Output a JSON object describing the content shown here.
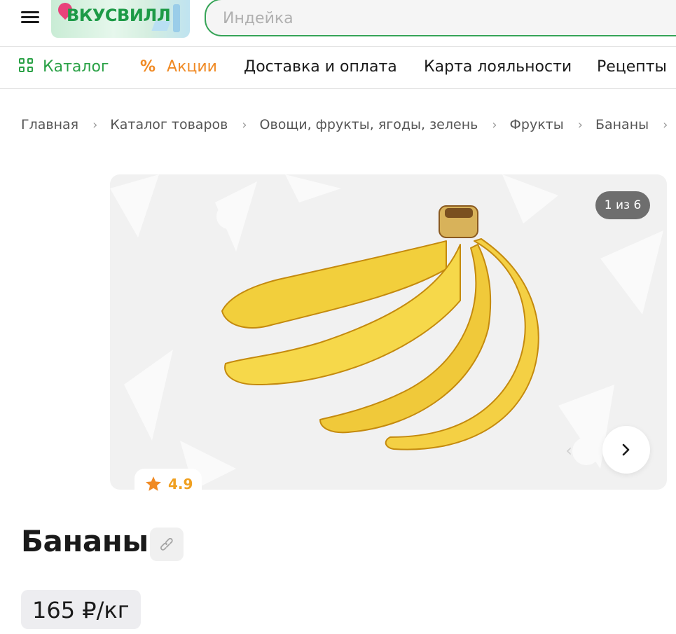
{
  "header": {
    "logo_text": "ВКУСВИЛЛ",
    "search_placeholder": "Индейка"
  },
  "nav": {
    "items": [
      {
        "label": "Каталог",
        "icon": "grid-icon",
        "color": "#2aa146"
      },
      {
        "label": "Акции",
        "icon": "percent-icon",
        "color": "#f08a24"
      },
      {
        "label": "Доставка и оплата"
      },
      {
        "label": "Карта лояльности"
      },
      {
        "label": "Рецепты"
      }
    ]
  },
  "breadcrumbs": [
    "Главная",
    "Каталог товаров",
    "Овощи, фрукты, ягоды, зелень",
    "Фрукты",
    "Бананы"
  ],
  "gallery": {
    "counter": "1 из 6",
    "current_image": 1,
    "total_images": 6
  },
  "product": {
    "rating": "4.9",
    "title": "Бананы",
    "price": "165 ₽/кг"
  },
  "colors": {
    "brand_green": "#2aa146",
    "promo_orange": "#f08a24",
    "rating_orange": "#f0a020"
  }
}
